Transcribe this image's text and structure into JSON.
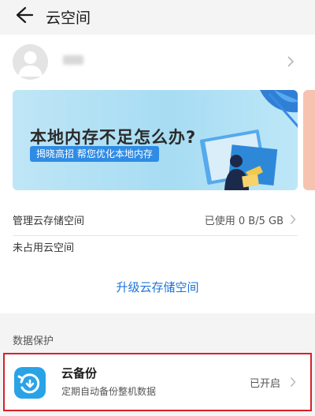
{
  "header": {
    "title": "云空间",
    "back_icon": "arrow-left-icon"
  },
  "profile": {
    "username": "**",
    "avatar_icon": "user-avatar-icon"
  },
  "banner": {
    "title": "本地内存不足怎么办?",
    "pill": "揭晓高招 帮您优化本地内存"
  },
  "storage": {
    "manage_label": "管理云存储空间",
    "usage_value": "已使用 0 B/5 GB",
    "used_fraction": 0,
    "unused_label": "未占用云空间"
  },
  "upgrade_label": "升级云存储空间",
  "protection": {
    "section_label": "数据保护",
    "backup_title": "云备份",
    "backup_subtitle": "定期自动备份整机数据",
    "backup_status": "已开启",
    "highlight_color": "#d8202a"
  },
  "colors": {
    "accent": "#1d73d9",
    "icon_blue": "#2aa3e6"
  }
}
